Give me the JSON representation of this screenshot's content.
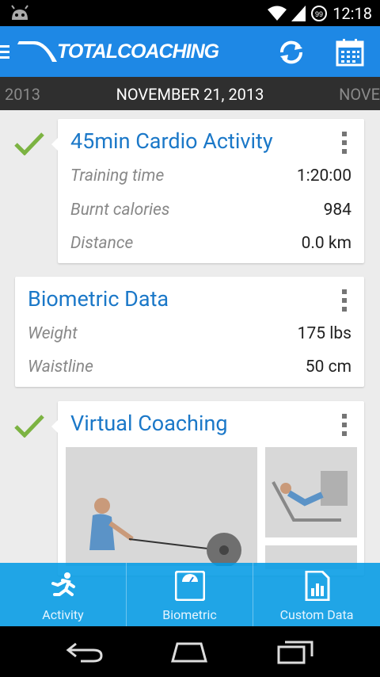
{
  "status": {
    "time": "12:18",
    "battery": "99"
  },
  "app": {
    "logo_text": "TOTALCOACHING"
  },
  "datebar": {
    "prev": "2013",
    "current": "NOVEMBER 21, 2013",
    "next": "NOVE"
  },
  "cardio": {
    "title": "45min Cardio Activity",
    "rows": [
      {
        "label": "Training time",
        "value": "1:20:00"
      },
      {
        "label": "Burnt calories",
        "value": "984"
      },
      {
        "label": "Distance",
        "value": "0.0 km"
      }
    ]
  },
  "biometric": {
    "title": "Biometric Data",
    "rows": [
      {
        "label": "Weight",
        "value": "175 lbs"
      },
      {
        "label": "Waistline",
        "value": "50 cm"
      }
    ]
  },
  "virtual": {
    "title": "Virtual Coaching"
  },
  "tabs": [
    {
      "label": "Activity"
    },
    {
      "label": "Biometric"
    },
    {
      "label": "Custom Data"
    }
  ],
  "colors": {
    "accent": "#1e88e5",
    "title": "#1b78c8",
    "check": "#7cb342"
  }
}
